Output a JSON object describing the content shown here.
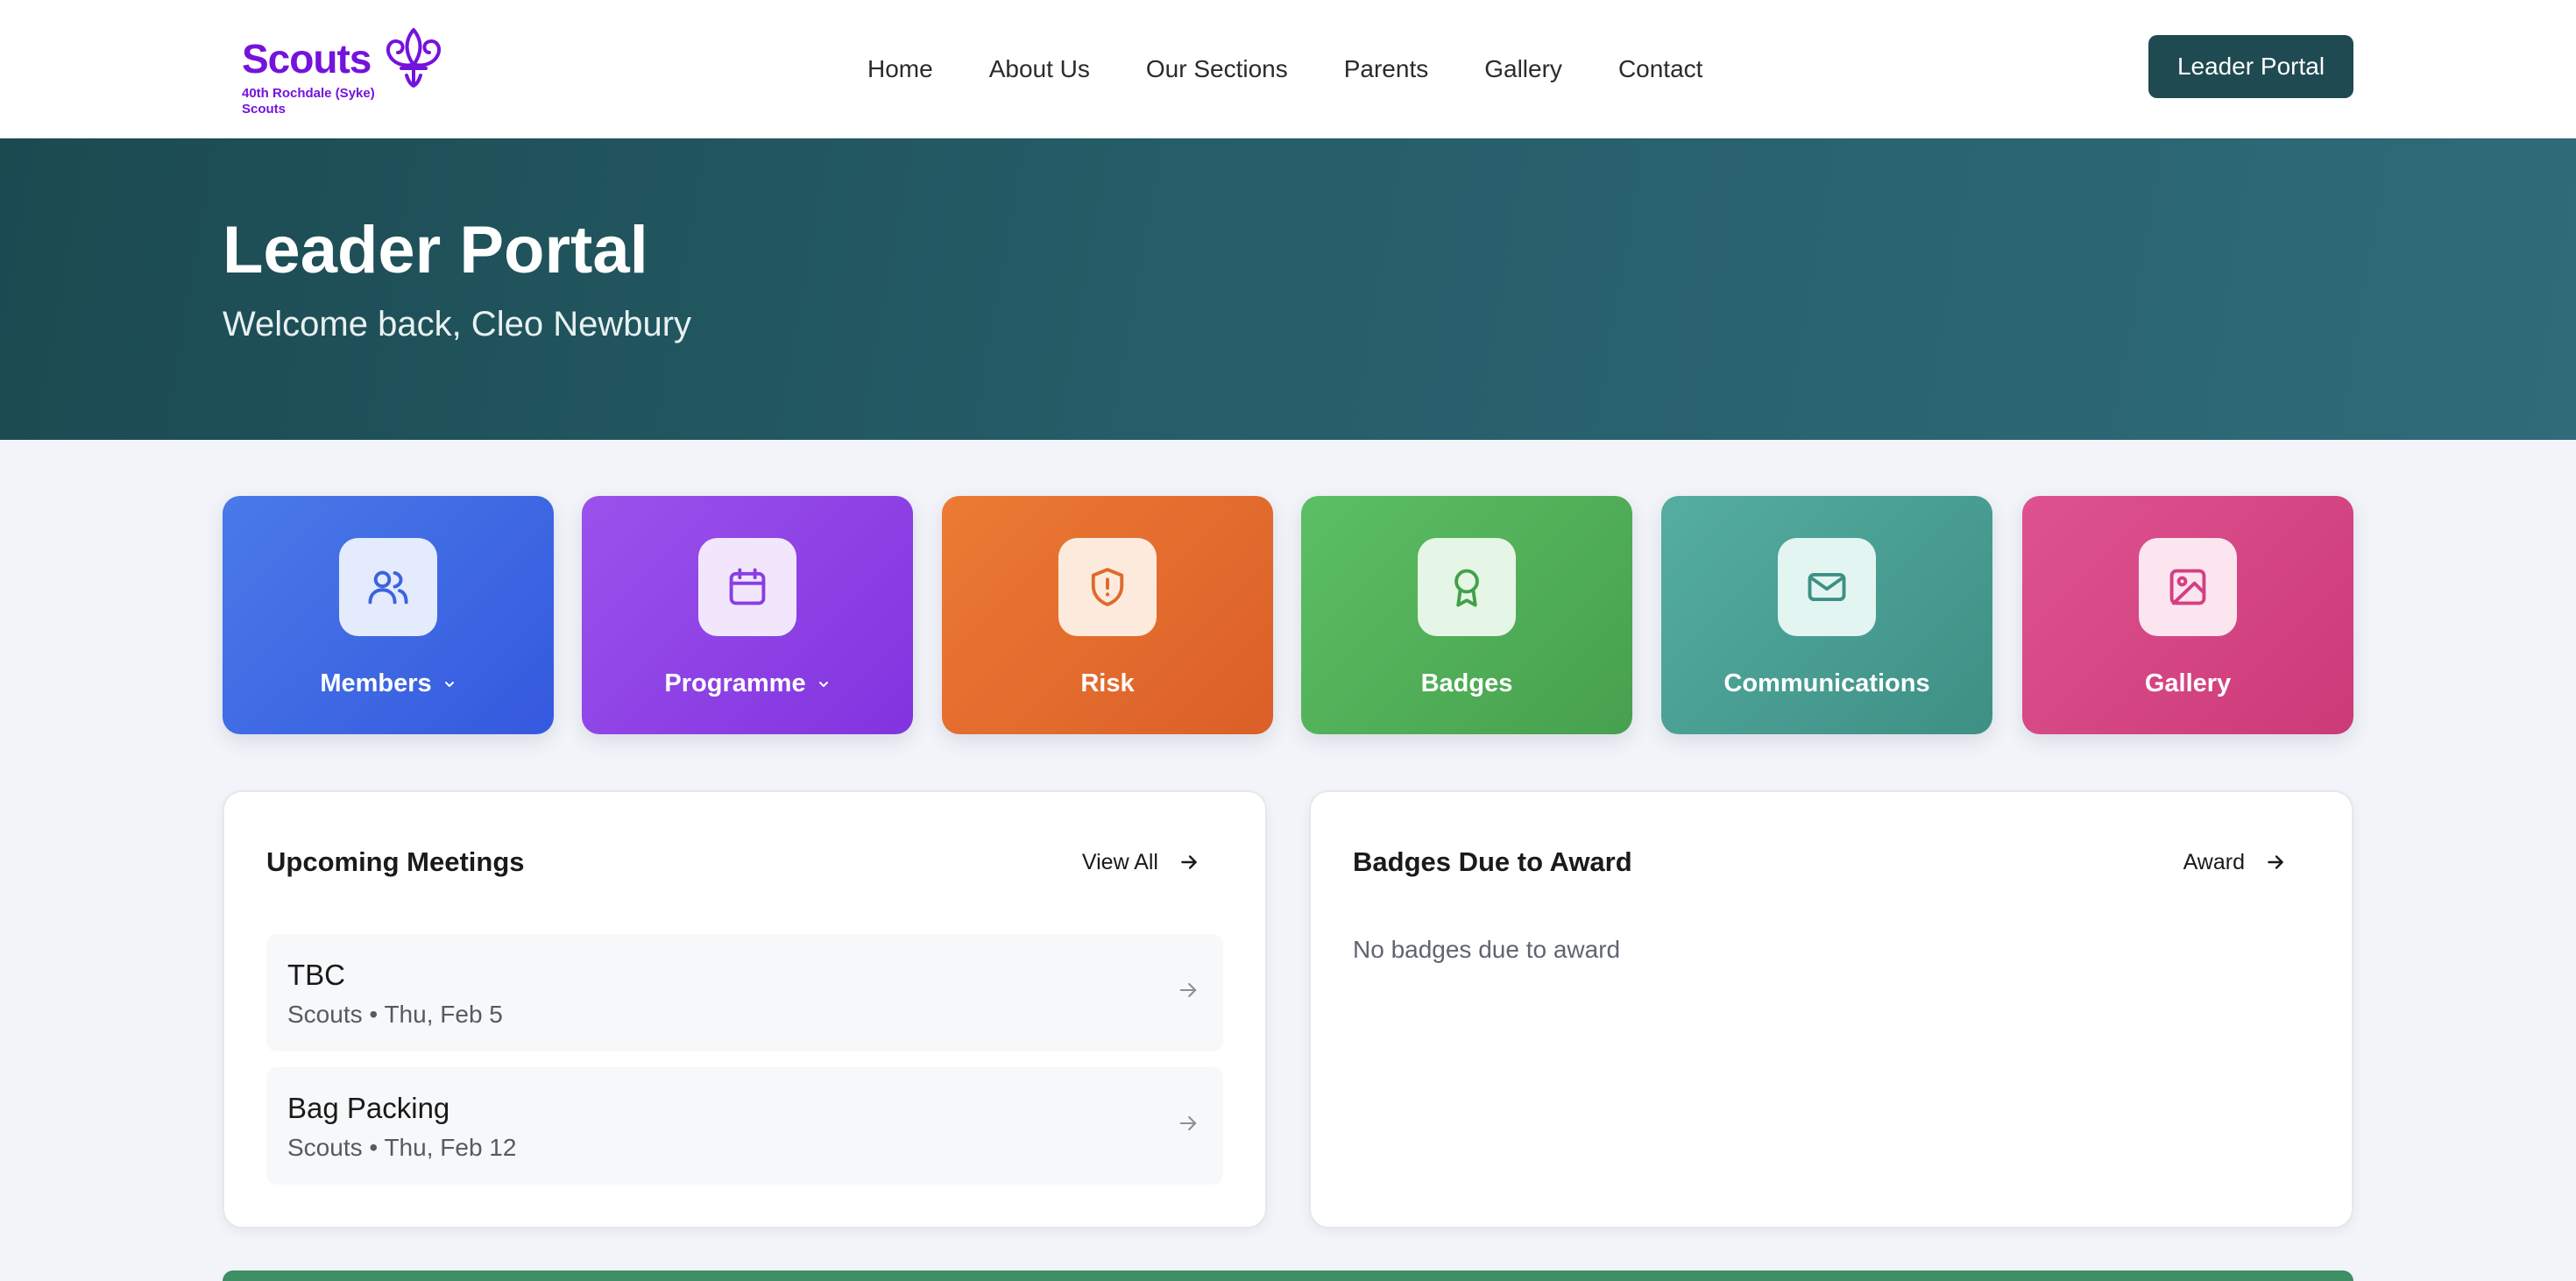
{
  "brand": {
    "name": "Scouts",
    "group": "40th Rochdale (Syke) Scouts",
    "color": "#7413dc"
  },
  "nav": {
    "links": [
      "Home",
      "About Us",
      "Our Sections",
      "Parents",
      "Gallery",
      "Contact"
    ],
    "portal_button": "Leader Portal"
  },
  "hero": {
    "title": "Leader Portal",
    "subtitle": "Welcome back, Cleo Newbury"
  },
  "tiles": [
    {
      "label": "Members",
      "icon": "users-icon",
      "has_dropdown": true,
      "color": "#3b63e0"
    },
    {
      "label": "Programme",
      "icon": "calendar-icon",
      "has_dropdown": true,
      "color": "#8a3ee3"
    },
    {
      "label": "Risk",
      "icon": "shield-alert-icon",
      "has_dropdown": false,
      "color": "#e06a2c"
    },
    {
      "label": "Badges",
      "icon": "award-icon",
      "has_dropdown": false,
      "color": "#4fab56"
    },
    {
      "label": "Communications",
      "icon": "mail-icon",
      "has_dropdown": false,
      "color": "#479a8e"
    },
    {
      "label": "Gallery",
      "icon": "image-icon",
      "has_dropdown": false,
      "color": "#d43f83"
    }
  ],
  "upcoming": {
    "title": "Upcoming Meetings",
    "action": "View All",
    "meetings": [
      {
        "title": "TBC",
        "meta": "Scouts • Thu, Feb 5"
      },
      {
        "title": "Bag Packing",
        "meta": "Scouts • Thu, Feb 12"
      }
    ]
  },
  "badges_due": {
    "title": "Badges Due to Award",
    "action": "Award",
    "empty": "No badges due to award"
  },
  "colors": {
    "header_bg": "#ffffff",
    "hero_bg": "#1f4a52",
    "portal_button_bg": "#1f4a52",
    "page_bg": "#f2f4f9",
    "bottom_strip": "#3f8f64"
  }
}
